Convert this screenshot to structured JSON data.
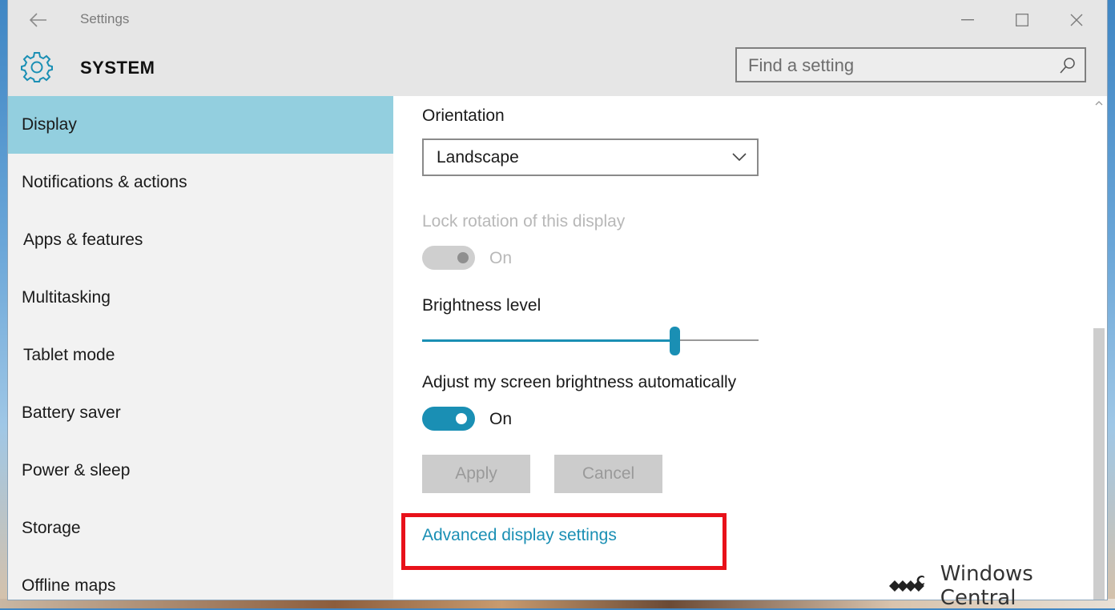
{
  "window": {
    "title": "Settings",
    "section": "SYSTEM",
    "search_placeholder": "Find a setting"
  },
  "icons": {
    "back": "back-arrow-icon",
    "minimize": "minimize-icon",
    "maximize": "maximize-icon",
    "close": "close-icon",
    "system": "gear-icon",
    "search": "search-icon",
    "dropdown": "chevron-down-icon"
  },
  "sidebar": {
    "items": [
      {
        "label": "Display",
        "active": true
      },
      {
        "label": "Notifications & actions",
        "active": false
      },
      {
        "label": "Apps & features",
        "active": false
      },
      {
        "label": "Multitasking",
        "active": false
      },
      {
        "label": "Tablet mode",
        "active": false
      },
      {
        "label": "Battery saver",
        "active": false
      },
      {
        "label": "Power & sleep",
        "active": false
      },
      {
        "label": "Storage",
        "active": false
      },
      {
        "label": "Offline maps",
        "active": false
      }
    ]
  },
  "display": {
    "orientation_label": "Orientation",
    "orientation_value": "Landscape",
    "lock_rotation_label": "Lock rotation of this display",
    "lock_rotation_state": "On",
    "brightness_label": "Brightness level",
    "brightness_level": 0.75,
    "auto_brightness_label": "Adjust my screen brightness automatically",
    "auto_brightness_state": "On",
    "apply_label": "Apply",
    "cancel_label": "Cancel",
    "advanced_link": "Advanced display settings"
  },
  "watermark": {
    "text": "Windows Central"
  },
  "colors": {
    "accent": "#1a8fb4",
    "active_nav": "#93cfdf",
    "highlight": "#e8111a"
  }
}
